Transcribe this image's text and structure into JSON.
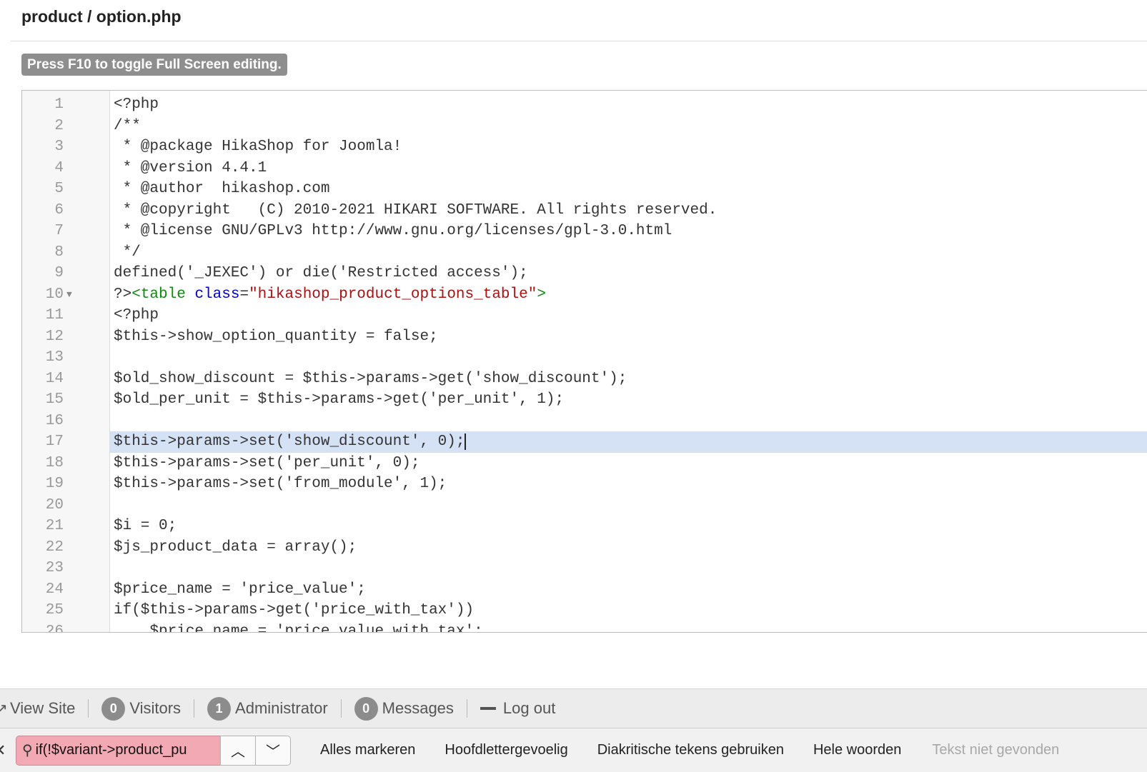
{
  "header": {
    "file_path": "product / option.php",
    "fullscreen_hint": "Press F10 to toggle Full Screen editing."
  },
  "editor": {
    "active_line": 17,
    "lines": [
      {
        "n": "1",
        "text": "<?php"
      },
      {
        "n": "2",
        "text": "/**"
      },
      {
        "n": "3",
        "text": " * @package HikaShop for Joomla!"
      },
      {
        "n": "4",
        "text": " * @version 4.4.1"
      },
      {
        "n": "5",
        "text": " * @author  hikashop.com"
      },
      {
        "n": "6",
        "text": " * @copyright   (C) 2010-2021 HIKARI SOFTWARE. All rights reserved."
      },
      {
        "n": "7",
        "text": " * @license GNU/GPLv3 http://www.gnu.org/licenses/gpl-3.0.html"
      },
      {
        "n": "8",
        "text": " */"
      },
      {
        "n": "9",
        "text": "defined('_JEXEC') or die('Restricted access');"
      },
      {
        "n": "10",
        "text": "?>",
        "tag_open": "<table",
        "attr": "class",
        "eq": "=",
        "str": "\"hikashop_product_options_table\"",
        "tag_close": ">"
      },
      {
        "n": "11",
        "text": "<?php"
      },
      {
        "n": "12",
        "text": "$this->show_option_quantity = false;"
      },
      {
        "n": "13",
        "text": ""
      },
      {
        "n": "14",
        "text": "$old_show_discount = $this->params->get('show_discount');"
      },
      {
        "n": "15",
        "text": "$old_per_unit = $this->params->get('per_unit', 1);"
      },
      {
        "n": "16",
        "text": ""
      },
      {
        "n": "17",
        "text": "$this->params->set('show_discount', 0);"
      },
      {
        "n": "18",
        "text": "$this->params->set('per_unit', 0);"
      },
      {
        "n": "19",
        "text": "$this->params->set('from_module', 1);"
      },
      {
        "n": "20",
        "text": ""
      },
      {
        "n": "21",
        "text": "$i = 0;"
      },
      {
        "n": "22",
        "text": "$js_product_data = array();"
      },
      {
        "n": "23",
        "text": ""
      },
      {
        "n": "24",
        "text": "$price_name = 'price_value';"
      },
      {
        "n": "25",
        "text": "if($this->params->get('price_with_tax'))"
      },
      {
        "n": "26",
        "text": "    $price_name = 'price_value_with_tax';"
      }
    ],
    "fold_icon": "fold-triangle-icon"
  },
  "admin_bar": {
    "view_site": "View Site",
    "visitors_count": "0",
    "visitors_label": "Visitors",
    "admin_count": "1",
    "admin_label": "Administrator",
    "messages_count": "0",
    "messages_label": "Messages",
    "logout_label": "Log out"
  },
  "find_bar": {
    "query": "if(!$variant->product_pu",
    "options": [
      "Alles markeren",
      "Hoofdlettergevoelig",
      "Diakritische tekens gebruiken",
      "Hele woorden"
    ],
    "status": "Tekst niet gevonden"
  },
  "colors": {
    "active_line": "#d5e1f5",
    "find_input_not_found": "#f3a9b3",
    "tag": "#118811",
    "attribute": "#0000cc",
    "string": "#aa1111"
  }
}
